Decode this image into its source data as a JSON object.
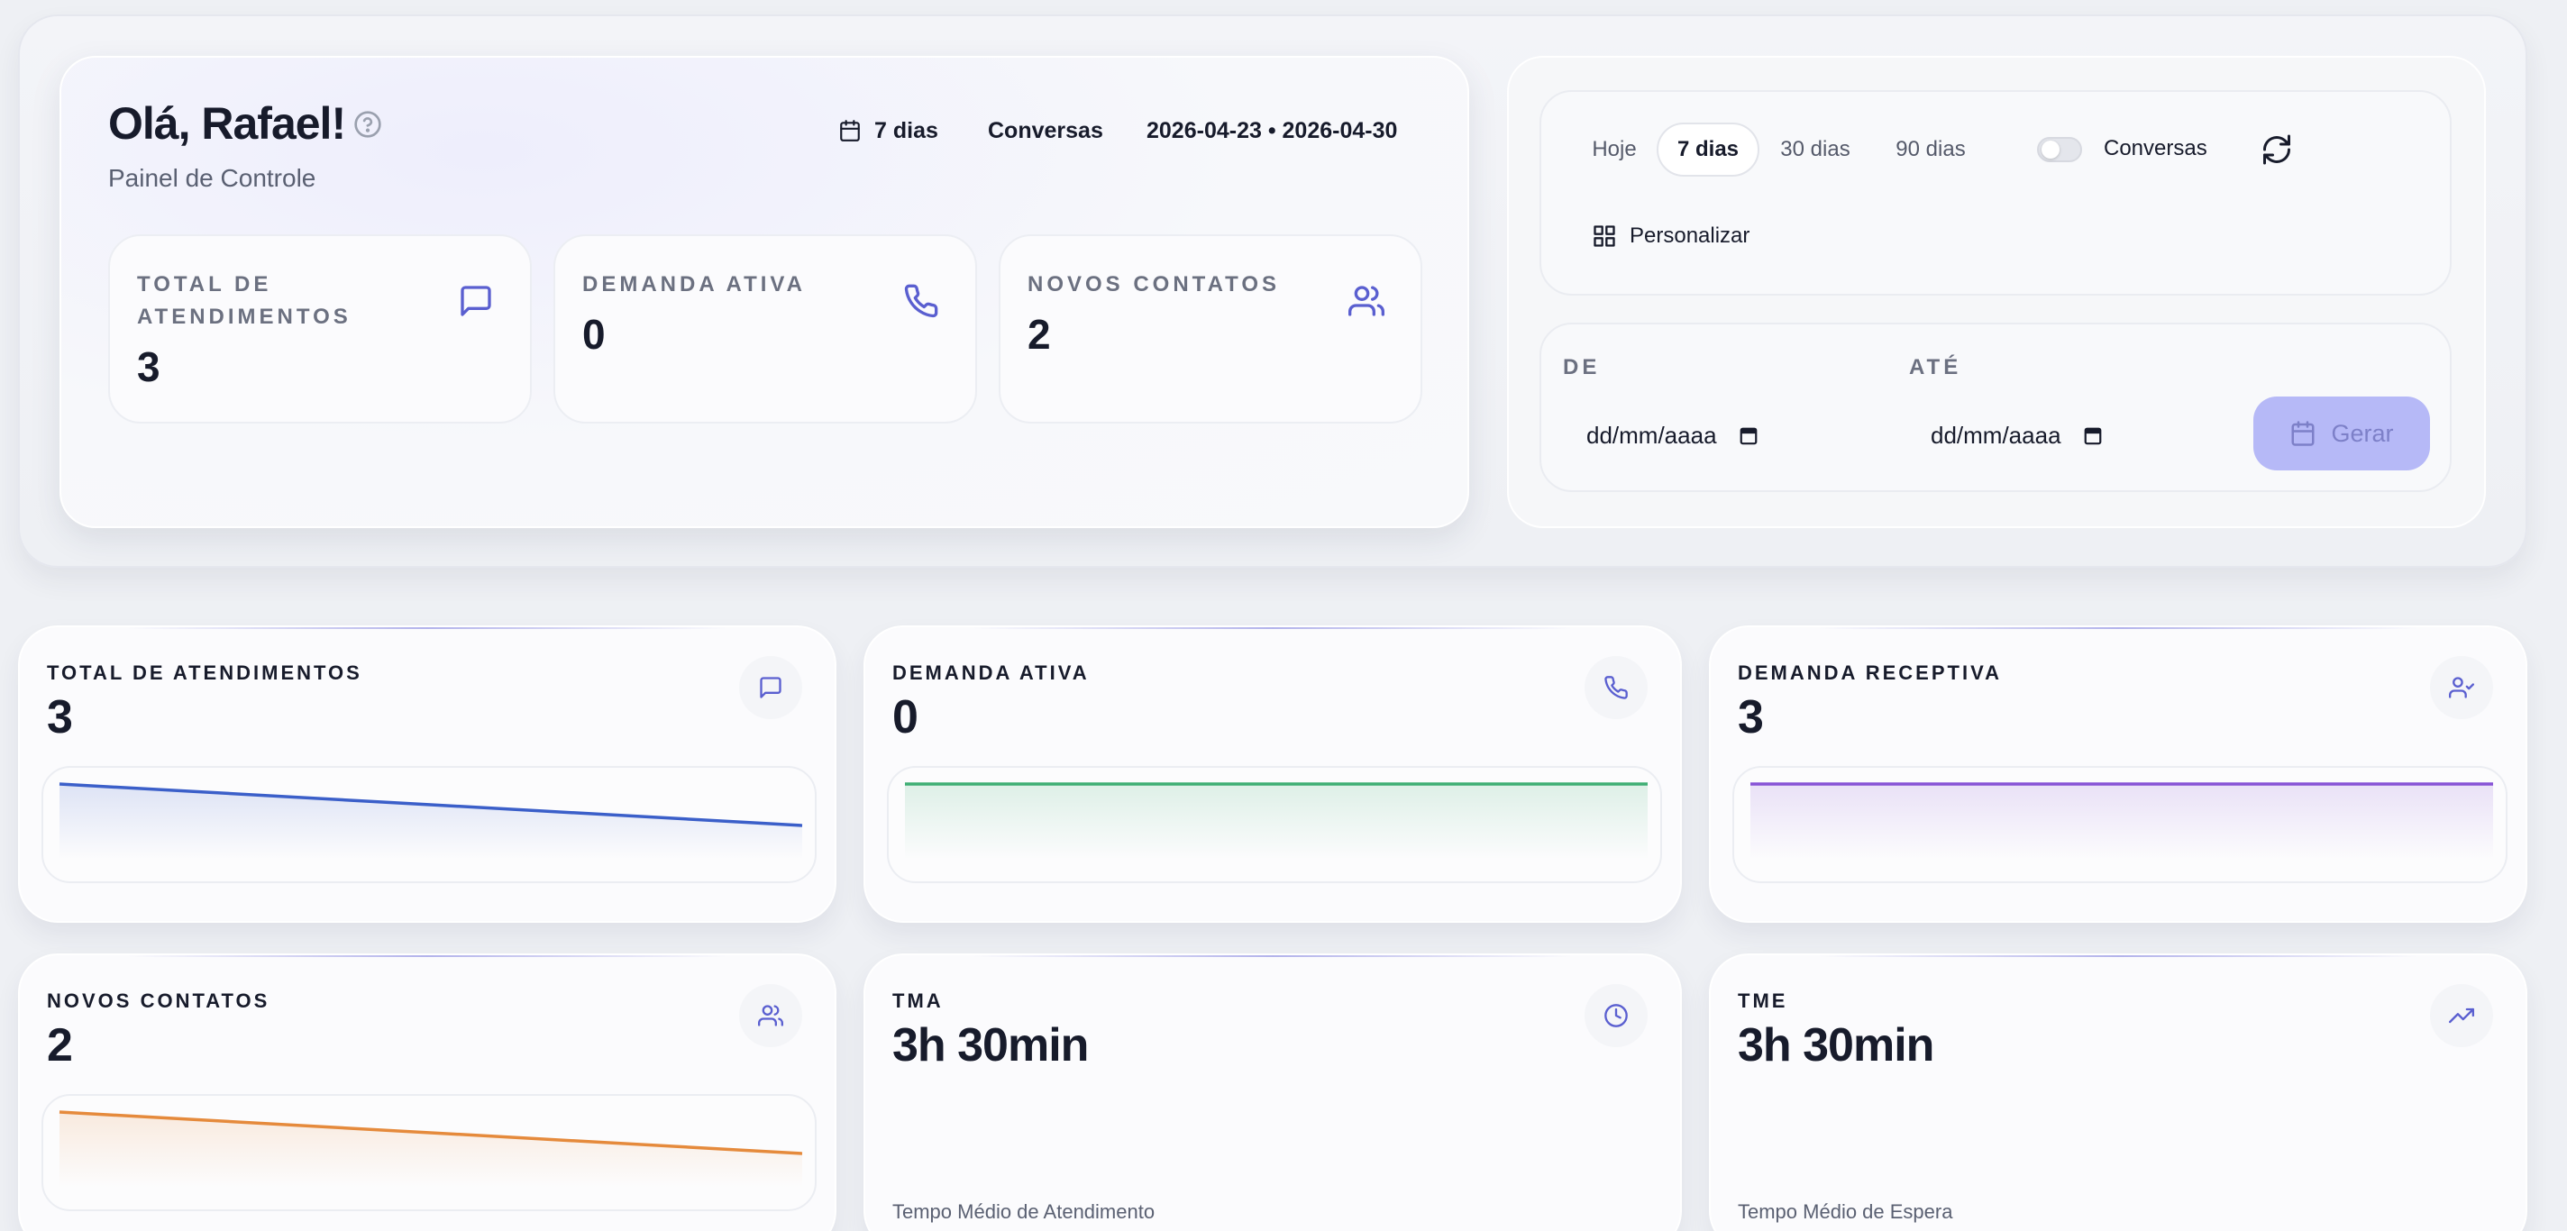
{
  "header": {
    "greeting": "Olá, Rafael!",
    "subtitle": "Painel de Controle",
    "summary": {
      "period": "7 dias",
      "mode": "Conversas",
      "date_range": "2026-04-23 • 2026-04-30"
    }
  },
  "summary_stats": [
    {
      "label": "TOTAL DE ATENDIMENTOS",
      "value": "3",
      "icon": "message-icon"
    },
    {
      "label": "DEMANDA ATIVA",
      "value": "0",
      "icon": "phone-icon"
    },
    {
      "label": "NOVOS CONTATOS",
      "value": "2",
      "icon": "users-icon"
    }
  ],
  "filters": {
    "ranges": [
      "Hoje",
      "7 dias",
      "30 dias",
      "90 dias"
    ],
    "active_range": "7 dias",
    "toggle_label": "Conversas",
    "toggle_on": false,
    "customize_label": "Personalizar",
    "from_label": "DE",
    "to_label": "ATÉ",
    "from_placeholder": "dd/mm/aaaa",
    "to_placeholder": "dd/mm/aaaa",
    "generate_label": "Gerar"
  },
  "metrics": [
    {
      "label": "TOTAL DE ATENDIMENTOS",
      "value": "3",
      "icon": "message-icon",
      "color": "#3b5fc9",
      "trend": [
        1.0,
        0.0
      ]
    },
    {
      "label": "DEMANDA ATIVA",
      "value": "0",
      "icon": "phone-icon",
      "color": "#3fae74",
      "trend": [
        0.5,
        0.5
      ]
    },
    {
      "label": "DEMANDA RECEPTIVA",
      "value": "3",
      "icon": "user-check-icon",
      "color": "#8753d6",
      "trend": [
        0.5,
        0.5
      ]
    },
    {
      "label": "NOVOS CONTATOS",
      "value": "2",
      "icon": "users-icon",
      "color": "#e58a3c",
      "trend": [
        1.0,
        0.0
      ]
    },
    {
      "label": "TMA",
      "value": "3h 30min",
      "icon": "clock-icon",
      "description": "Tempo Médio de Atendimento"
    },
    {
      "label": "TME",
      "value": "3h 30min",
      "icon": "trending-up-icon",
      "description": "Tempo Médio de Espera"
    }
  ],
  "colors": {
    "accent": "#5a5fd0",
    "button_disabled": "#b6b9f7"
  }
}
